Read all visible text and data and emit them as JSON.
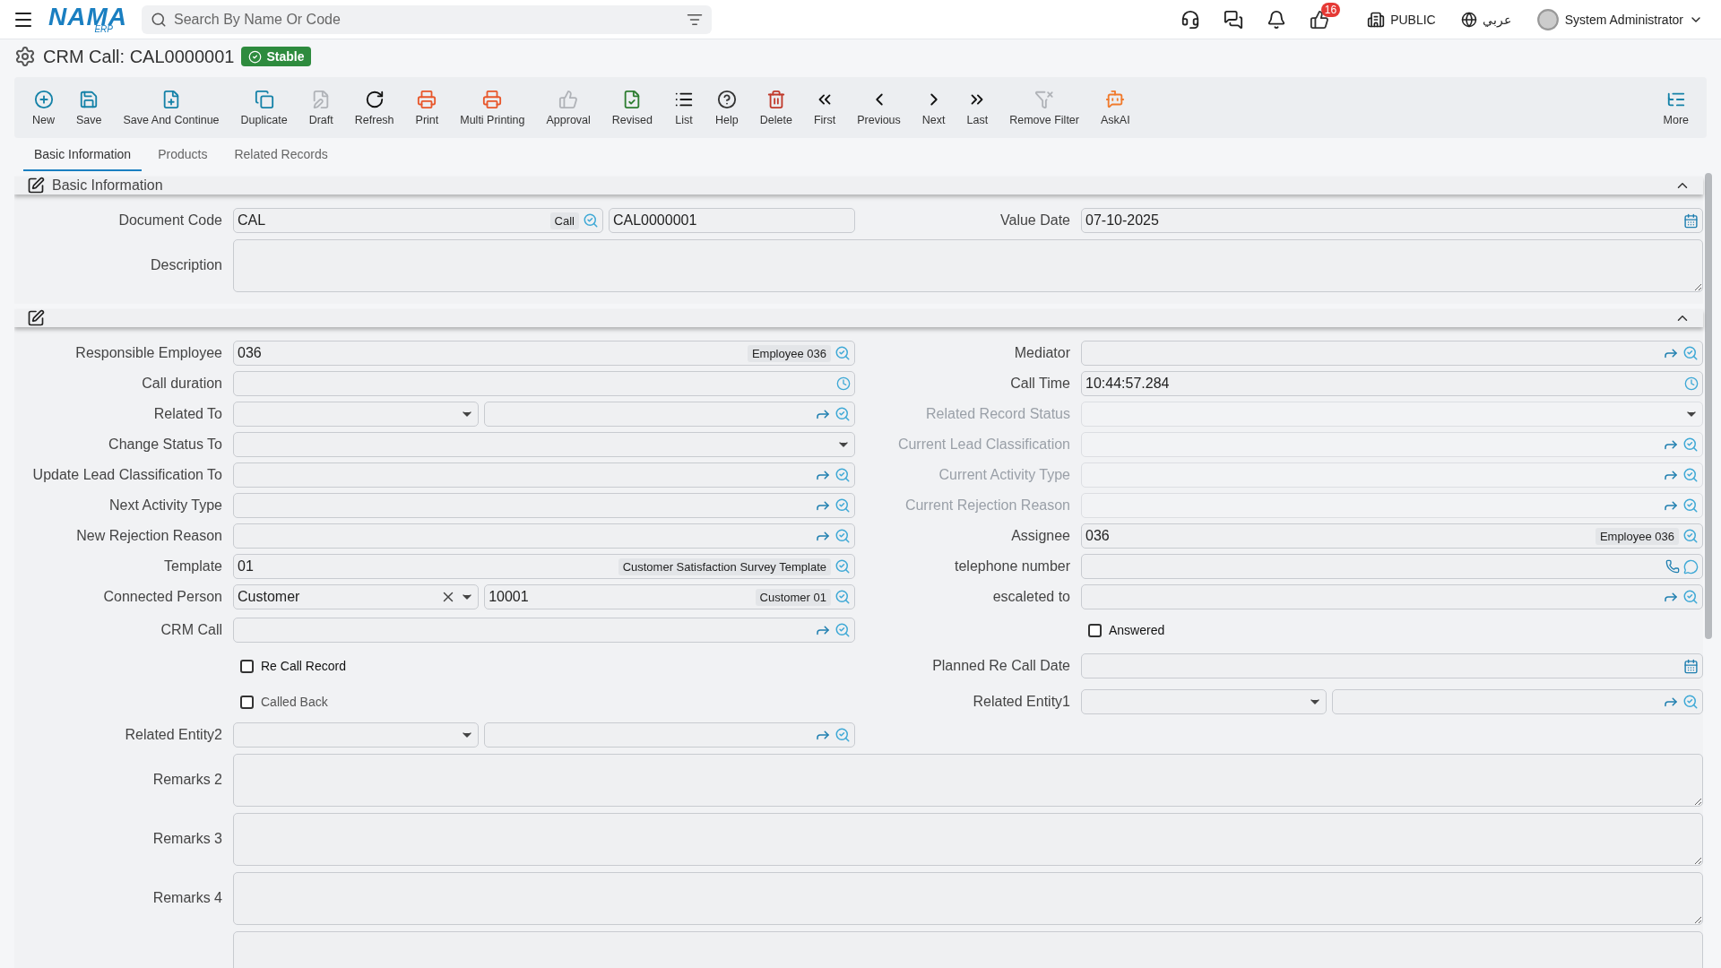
{
  "topbar": {
    "logo": "NAMA",
    "logo_sub": "ERP",
    "search": {
      "placeholder": "Search By Name Or Code"
    },
    "notification_count": "16",
    "company": "PUBLIC",
    "language": "عربي",
    "user": "System Administrator"
  },
  "title": {
    "text": "CRM Call: CAL0000001",
    "status": "Stable"
  },
  "toolbar": [
    {
      "label": "New",
      "disabled": false
    },
    {
      "label": "Save",
      "disabled": false
    },
    {
      "label": "Save And Continue",
      "disabled": false
    },
    {
      "label": "Duplicate",
      "disabled": false
    },
    {
      "label": "Draft",
      "disabled": true
    },
    {
      "label": "Refresh",
      "disabled": false
    },
    {
      "label": "Print",
      "disabled": false
    },
    {
      "label": "Multi Printing",
      "disabled": false
    },
    {
      "label": "Approval",
      "disabled": true
    },
    {
      "label": "Revised",
      "disabled": false
    },
    {
      "label": "List",
      "disabled": false
    },
    {
      "label": "Help",
      "disabled": false
    },
    {
      "label": "Delete",
      "disabled": false
    },
    {
      "label": "First",
      "disabled": false
    },
    {
      "label": "Previous",
      "disabled": false
    },
    {
      "label": "Next",
      "disabled": false
    },
    {
      "label": "Last",
      "disabled": false
    },
    {
      "label": "Remove Filter",
      "disabled": true
    },
    {
      "label": "AskAI",
      "disabled": false
    }
  ],
  "toolbar_more": "More",
  "tabs": [
    {
      "label": "Basic Information",
      "selected": true
    },
    {
      "label": "Products",
      "selected": false
    },
    {
      "label": "Related Records",
      "selected": false
    }
  ],
  "sections": [
    {
      "title": "Basic Information",
      "expanded": true,
      "rows": [
        {
          "left": {
            "kind": "inputs",
            "label": "Document Code",
            "inputs": [
              {
                "kind": "lookup",
                "value": "CAL",
                "tag": "Call"
              },
              {
                "kind": "plain",
                "value": "CAL0000001"
              }
            ]
          },
          "right": {
            "kind": "inputs",
            "label": "Value Date",
            "inputs": [
              {
                "kind": "date",
                "value": "07-10-2025"
              }
            ]
          }
        },
        {
          "full": {
            "kind": "inputs",
            "label": "Description",
            "inputs": [
              {
                "kind": "textarea"
              }
            ]
          }
        }
      ]
    },
    {
      "expanded": true,
      "rows": [
        {
          "left": {
            "kind": "inputs",
            "label": "Responsible Employee",
            "inputs": [
              {
                "kind": "lookup",
                "value": "036",
                "tag": "Employee 036"
              }
            ]
          },
          "right": {
            "kind": "inputs",
            "label": "Mediator",
            "inputs": [
              {
                "kind": "lookup",
                "link": true
              }
            ]
          }
        },
        {
          "left": {
            "kind": "inputs",
            "label": "Call duration",
            "inputs": [
              {
                "kind": "time"
              }
            ]
          },
          "right": {
            "kind": "inputs",
            "label": "Call Time",
            "inputs": [
              {
                "kind": "time",
                "value": "10:44:57.284"
              }
            ]
          }
        },
        {
          "left": {
            "kind": "inputs",
            "label": "Related To",
            "inputs": [
              {
                "kind": "select"
              },
              {
                "kind": "lookup",
                "link": true
              }
            ]
          },
          "right": {
            "kind": "inputs",
            "label": "Related Record Status",
            "disabled": true,
            "inputs": [
              {
                "kind": "select"
              }
            ]
          }
        },
        {
          "left": {
            "kind": "inputs",
            "label": "Change Status To",
            "inputs": [
              {
                "kind": "select"
              }
            ]
          },
          "right": {
            "kind": "inputs",
            "label": "Current Lead Classification",
            "disabled": true,
            "inputs": [
              {
                "kind": "lookup",
                "link": true
              }
            ]
          }
        },
        {
          "left": {
            "kind": "inputs",
            "label": "Update Lead Classification To",
            "inputs": [
              {
                "kind": "lookup",
                "link": true
              }
            ]
          },
          "right": {
            "kind": "inputs",
            "label": "Current Activity Type",
            "disabled": true,
            "inputs": [
              {
                "kind": "lookup",
                "link": true
              }
            ]
          }
        },
        {
          "left": {
            "kind": "inputs",
            "label": "Next Activity Type",
            "inputs": [
              {
                "kind": "lookup",
                "link": true
              }
            ]
          },
          "right": {
            "kind": "inputs",
            "label": "Current Rejection Reason",
            "disabled": true,
            "inputs": [
              {
                "kind": "lookup",
                "link": true
              }
            ]
          }
        },
        {
          "left": {
            "kind": "inputs",
            "label": "New Rejection Reason",
            "inputs": [
              {
                "kind": "lookup",
                "link": true
              }
            ]
          },
          "right": {
            "kind": "inputs",
            "label": "Assignee",
            "inputs": [
              {
                "kind": "lookup",
                "value": "036",
                "tag": "Employee 036"
              }
            ]
          }
        },
        {
          "left": {
            "kind": "inputs",
            "label": "Template",
            "inputs": [
              {
                "kind": "lookup",
                "value": "01",
                "tag": "Customer Satisfaction Survey Template"
              }
            ]
          },
          "right": {
            "kind": "inputs",
            "label": "telephone number",
            "inputs": [
              {
                "kind": "phone"
              }
            ]
          }
        },
        {
          "left": {
            "kind": "inputs",
            "label": "Connected Person",
            "inputs": [
              {
                "kind": "select",
                "value": "Customer",
                "clearable": true
              },
              {
                "kind": "lookup",
                "value": "10001",
                "tag": "Customer 01"
              }
            ]
          },
          "right": {
            "kind": "inputs",
            "label": "escaleted to",
            "inputs": [
              {
                "kind": "lookup",
                "link": true
              }
            ]
          }
        },
        {
          "left": {
            "kind": "inputs",
            "label": "CRM Call",
            "inputs": [
              {
                "kind": "lookup",
                "link": true
              }
            ]
          },
          "right": {
            "kind": "checkbox",
            "label": "Answered",
            "checked": false,
            "disabled": false
          }
        },
        {
          "left": {
            "kind": "checkbox",
            "label": "Re Call Record",
            "checked": false,
            "disabled": false
          },
          "right": {
            "kind": "inputs",
            "label": "Planned Re Call Date",
            "inputs": [
              {
                "kind": "date"
              }
            ]
          }
        },
        {
          "left": {
            "kind": "checkbox",
            "label": "Called Back",
            "checked": false,
            "disabled": true
          },
          "right": {
            "kind": "inputs",
            "label": "Related Entity1",
            "inputs": [
              {
                "kind": "select"
              },
              {
                "kind": "lookup",
                "link": true
              }
            ]
          }
        },
        {
          "left": {
            "kind": "inputs",
            "label": "Related Entity2",
            "inputs": [
              {
                "kind": "select"
              },
              {
                "kind": "lookup",
                "link": true
              }
            ]
          }
        },
        {
          "full": {
            "kind": "inputs",
            "label": "Remarks 2",
            "inputs": [
              {
                "kind": "textarea"
              }
            ]
          }
        },
        {
          "full": {
            "kind": "inputs",
            "label": "Remarks 3",
            "inputs": [
              {
                "kind": "textarea"
              }
            ]
          }
        },
        {
          "full": {
            "kind": "inputs",
            "label": "Remarks 4",
            "inputs": [
              {
                "kind": "textarea"
              }
            ]
          }
        },
        {
          "full": {
            "kind": "inputs",
            "inputs": [
              {
                "kind": "textarea"
              }
            ]
          }
        }
      ]
    }
  ]
}
